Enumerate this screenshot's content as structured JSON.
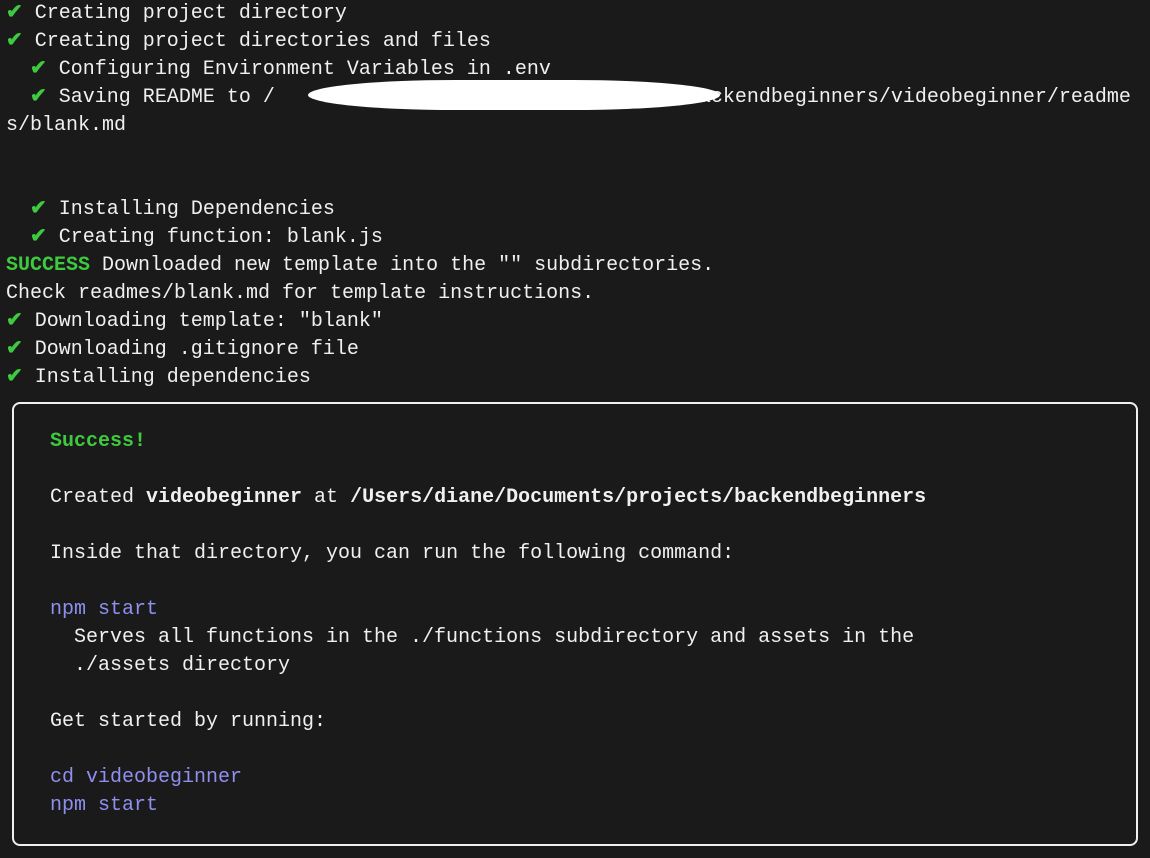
{
  "icons": {
    "check": "✔"
  },
  "log": {
    "l1": "Creating project directory",
    "l2": "Creating project directories and files",
    "l3": "Configuring Environment Variables in .env",
    "l4a": "Saving README to /",
    "l4b": "/backendbeginners/videobeginner/readmes/blank.md",
    "l5": "Installing Dependencies",
    "l6": "Creating function: blank.js",
    "success_word": "SUCCESS",
    "success_rest": " Downloaded new template into the \"\" subdirectories.",
    "check_line": "Check readmes/blank.md for template instructions.",
    "l7": "Downloading template: \"blank\"",
    "l8": "Downloading .gitignore file",
    "l9": "Installing dependencies"
  },
  "box": {
    "success": "Success!",
    "created_prefix": "Created ",
    "project_name": "videobeginner",
    "at_word": " at ",
    "project_path": "/Users/diane/Documents/projects/backendbeginners",
    "inside_line": "Inside that directory, you can run the following command:",
    "cmd1": "npm start",
    "cmd1_desc1": "Serves all functions in the ./functions subdirectory and assets in the",
    "cmd1_desc2": "./assets directory",
    "getstarted": "Get started by running:",
    "cmd2a": "cd videobeginner",
    "cmd2b": "npm start"
  }
}
